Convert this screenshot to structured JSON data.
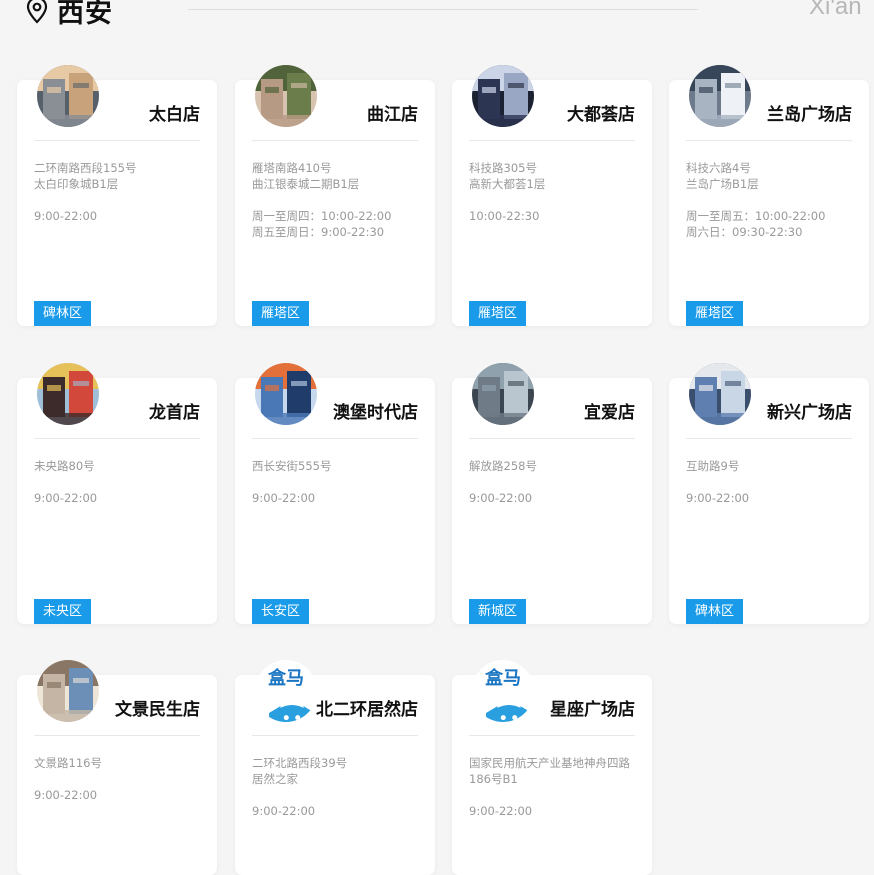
{
  "header": {
    "city_cn": "西安",
    "city_en": "Xi'an"
  },
  "colors": {
    "accent": "#1a9bea",
    "page_bg": "#f5f5f5",
    "muted_text": "#999999"
  },
  "stores": [
    {
      "name": "太白店",
      "address": [
        "二环南路西段155号",
        "太白印象城B1层"
      ],
      "hours": [
        "9:00-22:00"
      ],
      "district": "碑林区",
      "photo": "store-photo"
    },
    {
      "name": "曲江店",
      "address": [
        "雁塔南路410号",
        "曲江银泰城二期B1层"
      ],
      "hours": [
        "周一至周四：10:00-22:00",
        "周五至周日：9:00-22:30"
      ],
      "district": "雁塔区",
      "photo": "store-photo"
    },
    {
      "name": "大都荟店",
      "address": [
        "科技路305号",
        "高新大都荟1层"
      ],
      "hours": [
        "10:00-22:30"
      ],
      "district": "雁塔区",
      "photo": "store-photo"
    },
    {
      "name": "兰岛广场店",
      "address": [
        "科技六路4号",
        "兰岛广场B1层"
      ],
      "hours": [
        "周一至周五：10:00-22:00",
        "周六日：09:30-22:30"
      ],
      "district": "雁塔区",
      "photo": "store-photo"
    },
    {
      "name": "龙首店",
      "address": [
        "未央路80号"
      ],
      "hours": [
        "9:00-22:00"
      ],
      "district": "未央区",
      "photo": "store-photo"
    },
    {
      "name": "澳堡时代店",
      "address": [
        "西长安街555号"
      ],
      "hours": [
        "9:00-22:00"
      ],
      "district": "长安区",
      "photo": "store-photo"
    },
    {
      "name": "宜爱店",
      "address": [
        "解放路258号"
      ],
      "hours": [
        "9:00-22:00"
      ],
      "district": "新城区",
      "photo": "store-photo"
    },
    {
      "name": "新兴广场店",
      "address": [
        "互助路9号"
      ],
      "hours": [
        "9:00-22:00"
      ],
      "district": "碑林区",
      "photo": "store-photo"
    },
    {
      "name": "文景民生店",
      "address": [
        "文景路116号"
      ],
      "hours": [
        "9:00-22:00"
      ],
      "district": "",
      "photo": "store-photo"
    },
    {
      "name": "北二环居然店",
      "address": [
        "二环北路西段39号",
        "居然之家"
      ],
      "hours": [
        "9:00-22:00"
      ],
      "district": "",
      "photo": "hema-logo",
      "logo_text": "盒马"
    },
    {
      "name": "星座广场店",
      "address": [
        "国家民用航天产业基地神舟四路186号B1"
      ],
      "hours": [
        "9:00-22:00"
      ],
      "district": "",
      "photo": "hema-logo",
      "logo_text": "盒马"
    }
  ]
}
